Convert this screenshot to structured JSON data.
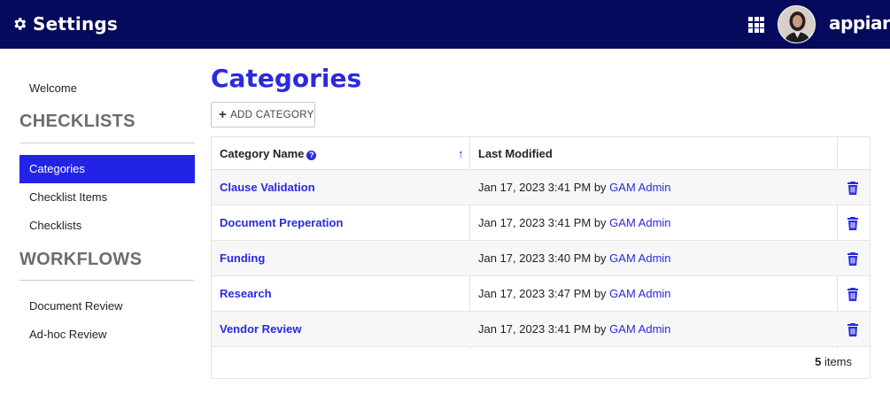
{
  "header": {
    "title": "Settings",
    "logo_text": "appian"
  },
  "sidebar": {
    "items": [
      {
        "label": "Welcome"
      },
      {
        "heading": "CHECKLISTS"
      },
      {
        "label": "Categories",
        "active": true
      },
      {
        "label": "Checklist Items"
      },
      {
        "label": "Checklists"
      },
      {
        "heading": "WORKFLOWS"
      },
      {
        "label": "Document Review"
      },
      {
        "label": "Ad-hoc Review"
      }
    ]
  },
  "main": {
    "title": "Categories",
    "add_button_label": "ADD CATEGORY",
    "table": {
      "columns": [
        "Category Name",
        "Last Modified"
      ],
      "rows": [
        {
          "name": "Clause Validation",
          "modified": "Jan 17, 2023 3:41 PM by ",
          "user": "GAM Admin"
        },
        {
          "name": "Document Preperation",
          "modified": "Jan 17, 2023 3:41 PM by ",
          "user": "GAM Admin"
        },
        {
          "name": "Funding",
          "modified": "Jan 17, 2023 3:40 PM by ",
          "user": "GAM Admin"
        },
        {
          "name": "Research",
          "modified": "Jan 17, 2023 3:47 PM by ",
          "user": "GAM Admin"
        },
        {
          "name": "Vendor Review",
          "modified": "Jan 17, 2023 3:41 PM by ",
          "user": "GAM Admin"
        }
      ],
      "count_number": "5",
      "count_label": " items"
    }
  },
  "colors": {
    "header_bg": "#050a5c",
    "accent": "#2a2ae0",
    "active_nav": "#2323e8"
  }
}
